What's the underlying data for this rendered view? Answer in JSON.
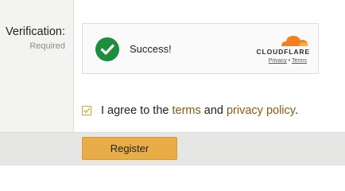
{
  "form": {
    "verification_label": "Verification:",
    "required_label": "Required"
  },
  "captcha": {
    "status_text": "Success!",
    "status_icon": "check-circle-icon",
    "brand": "CLOUDFLARE",
    "privacy_link": "Privacy",
    "separator": "•",
    "terms_link": "Terms",
    "colors": {
      "success": "#1e8e3e",
      "brand_orange": "#f38020"
    }
  },
  "agreement": {
    "checked": true,
    "text_prefix": "I agree to the ",
    "terms_link": "terms",
    "text_middle": " and ",
    "privacy_link": "privacy policy",
    "text_suffix": "."
  },
  "actions": {
    "register_label": "Register",
    "accent_color": "#e8ad47"
  }
}
